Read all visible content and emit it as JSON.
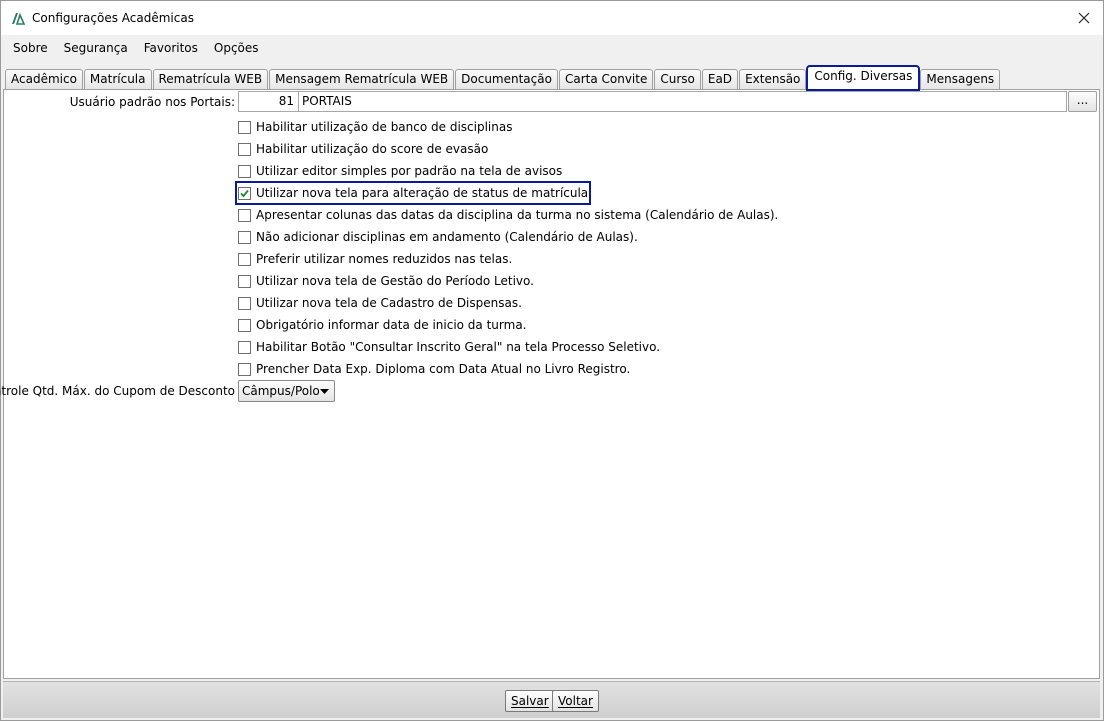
{
  "window": {
    "title": "Configurações Acadêmicas"
  },
  "menu": [
    {
      "label": "Sobre",
      "name": "menu-sobre"
    },
    {
      "label": "Segurança",
      "name": "menu-seguranca"
    },
    {
      "label": "Favoritos",
      "name": "menu-favoritos"
    },
    {
      "label": "Opções",
      "name": "menu-opcoes"
    }
  ],
  "tabs": [
    {
      "label": "Acadêmico"
    },
    {
      "label": "Matrícula"
    },
    {
      "label": "Rematrícula WEB"
    },
    {
      "label": "Mensagem Rematrícula WEB"
    },
    {
      "label": "Documentação"
    },
    {
      "label": "Carta Convite"
    },
    {
      "label": "Curso"
    },
    {
      "label": "EaD"
    },
    {
      "label": "Extensão"
    },
    {
      "label": "Config. Diversas",
      "active": true
    },
    {
      "label": "Mensagens"
    }
  ],
  "portal_user": {
    "label": "Usuário padrão nos Portais:",
    "code": "81",
    "name": "PORTAIS",
    "lookup_button": "..."
  },
  "options": [
    {
      "label": "Habilitar utilização de banco de disciplinas",
      "checked": false
    },
    {
      "label": "Habilitar utilização do score de evasão",
      "checked": false
    },
    {
      "label": "Utilizar editor simples por padrão na tela de avisos",
      "checked": false
    },
    {
      "label": "Utilizar nova tela para alteração de status de matrícula",
      "checked": true,
      "highlighted": true
    },
    {
      "label": "Apresentar colunas das datas da disciplina da turma no sistema (Calendário de Aulas).",
      "checked": false
    },
    {
      "label": "Não adicionar disciplinas em andamento (Calendário de Aulas).",
      "checked": false
    },
    {
      "label": "Preferir utilizar nomes reduzidos nas telas.",
      "checked": false
    },
    {
      "label": "Utilizar nova tela de Gestão do Período Letivo.",
      "checked": false
    },
    {
      "label": "Utilizar nova tela de Cadastro de Dispensas.",
      "checked": false
    },
    {
      "label": "Obrigatório informar data de inicio da turma.",
      "checked": false
    },
    {
      "label": "Habilitar Botão \"Consultar Inscrito Geral\" na tela Processo Seletivo.",
      "checked": false
    },
    {
      "label": "Prencher Data Exp. Diploma com Data Atual no Livro Registro.",
      "checked": false
    }
  ],
  "coupon_control": {
    "label": "Controle Qtd. Máx. do Cupom de Desconto",
    "selected": "Câmpus/Polo"
  },
  "footer": {
    "save": "Salvar",
    "back": "Voltar"
  },
  "colors": {
    "highlight": "#0a1a9c",
    "check_green": "#1a8a2a"
  }
}
